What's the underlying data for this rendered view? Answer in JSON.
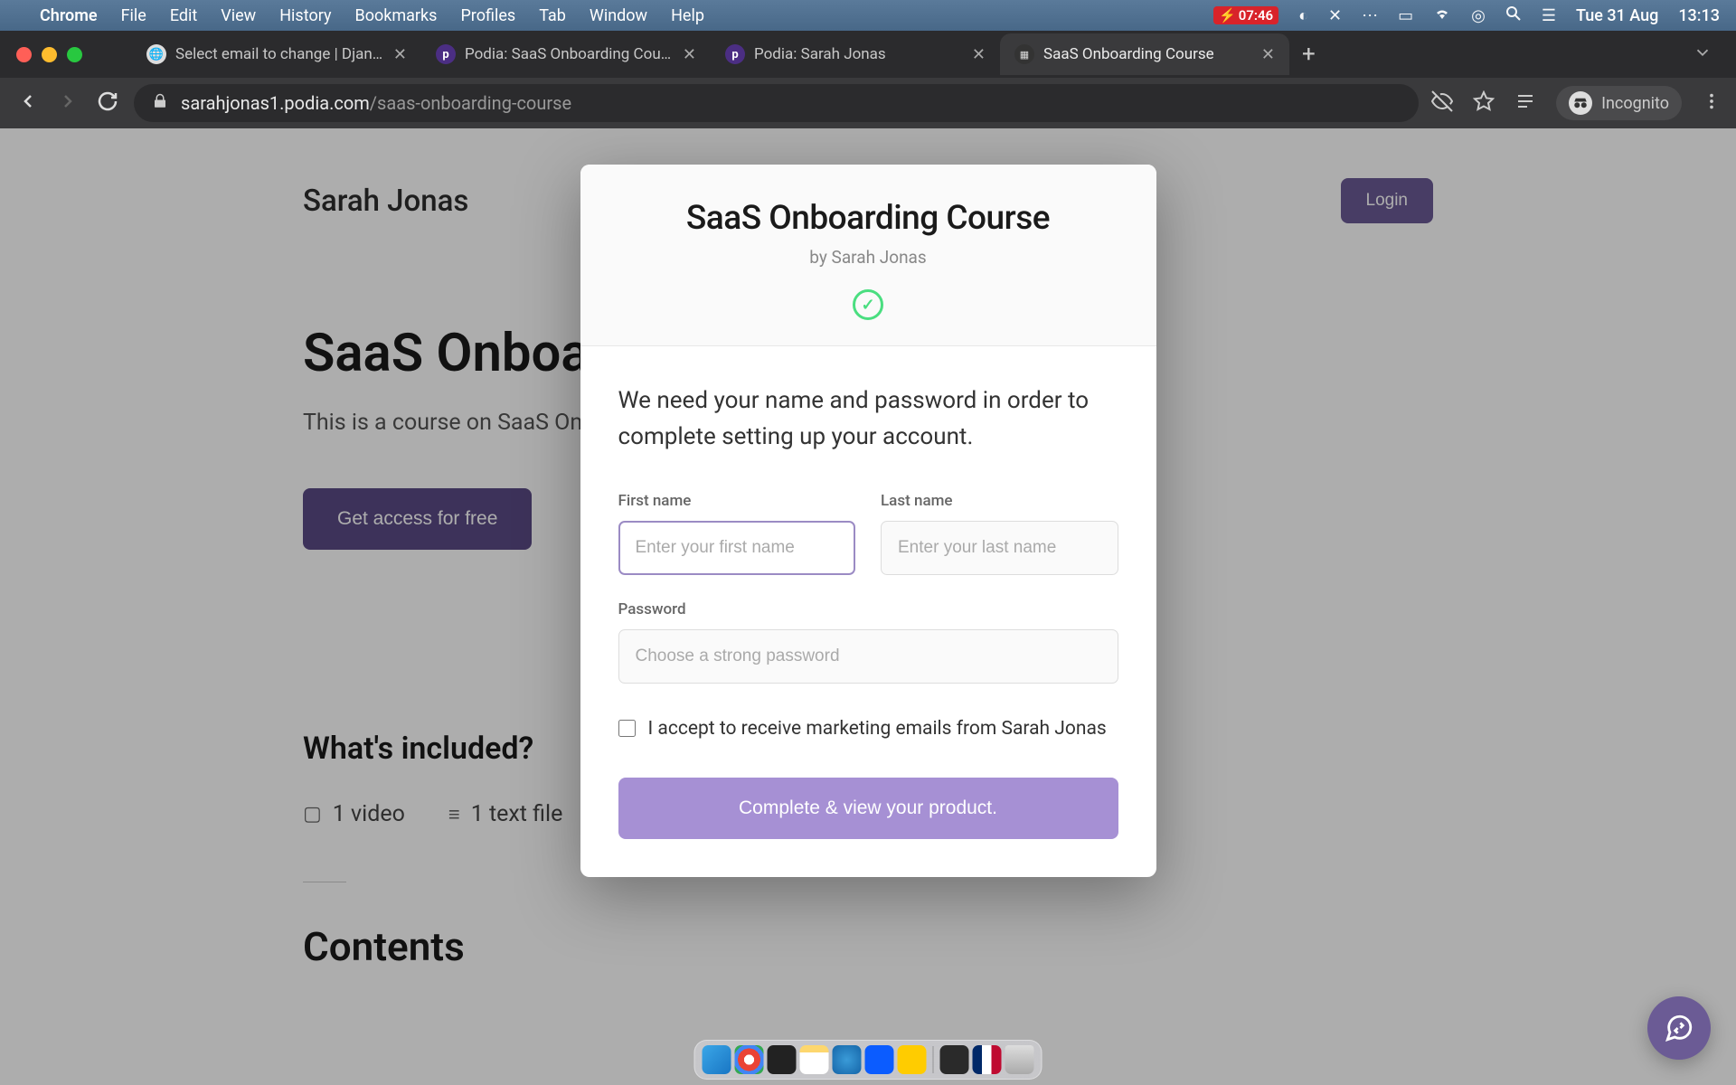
{
  "menubar": {
    "app": "Chrome",
    "items": [
      "File",
      "Edit",
      "View",
      "History",
      "Bookmarks",
      "Profiles",
      "Tab",
      "Window",
      "Help"
    ],
    "battery": "07:46",
    "date": "Tue 31 Aug",
    "time": "13:13"
  },
  "tabs": [
    {
      "title": "Select email to change | Django",
      "favicon": "globe"
    },
    {
      "title": "Podia: SaaS Onboarding Cours",
      "favicon": "podia"
    },
    {
      "title": "Podia: Sarah Jonas",
      "favicon": "podia"
    },
    {
      "title": "SaaS Onboarding Course",
      "favicon": "grid",
      "active": true
    }
  ],
  "address": {
    "host": "sarahjonas1.podia.com",
    "path": "/saas-onboarding-course",
    "mode": "Incognito"
  },
  "site": {
    "brand": "Sarah Jonas",
    "login": "Login",
    "hero_title": "SaaS Onboarding Course",
    "hero_sub": "This is a course on SaaS Onb",
    "cta": "Get access for free",
    "included_title": "What's included?",
    "included": [
      {
        "icon": "▢",
        "label": "1 video"
      },
      {
        "icon": "≡",
        "label": "1 text file"
      }
    ],
    "contents_title": "Contents"
  },
  "modal": {
    "title": "SaaS Onboarding Course",
    "byline": "by Sarah Jonas",
    "message": "We need your name and password in order to complete setting up your account.",
    "first_name_label": "First name",
    "first_name_placeholder": "Enter your first name",
    "last_name_label": "Last name",
    "last_name_placeholder": "Enter your last name",
    "password_label": "Password",
    "password_placeholder": "Choose a strong password",
    "consent": "I accept to receive marketing emails from Sarah Jonas",
    "submit": "Complete & view your product."
  }
}
